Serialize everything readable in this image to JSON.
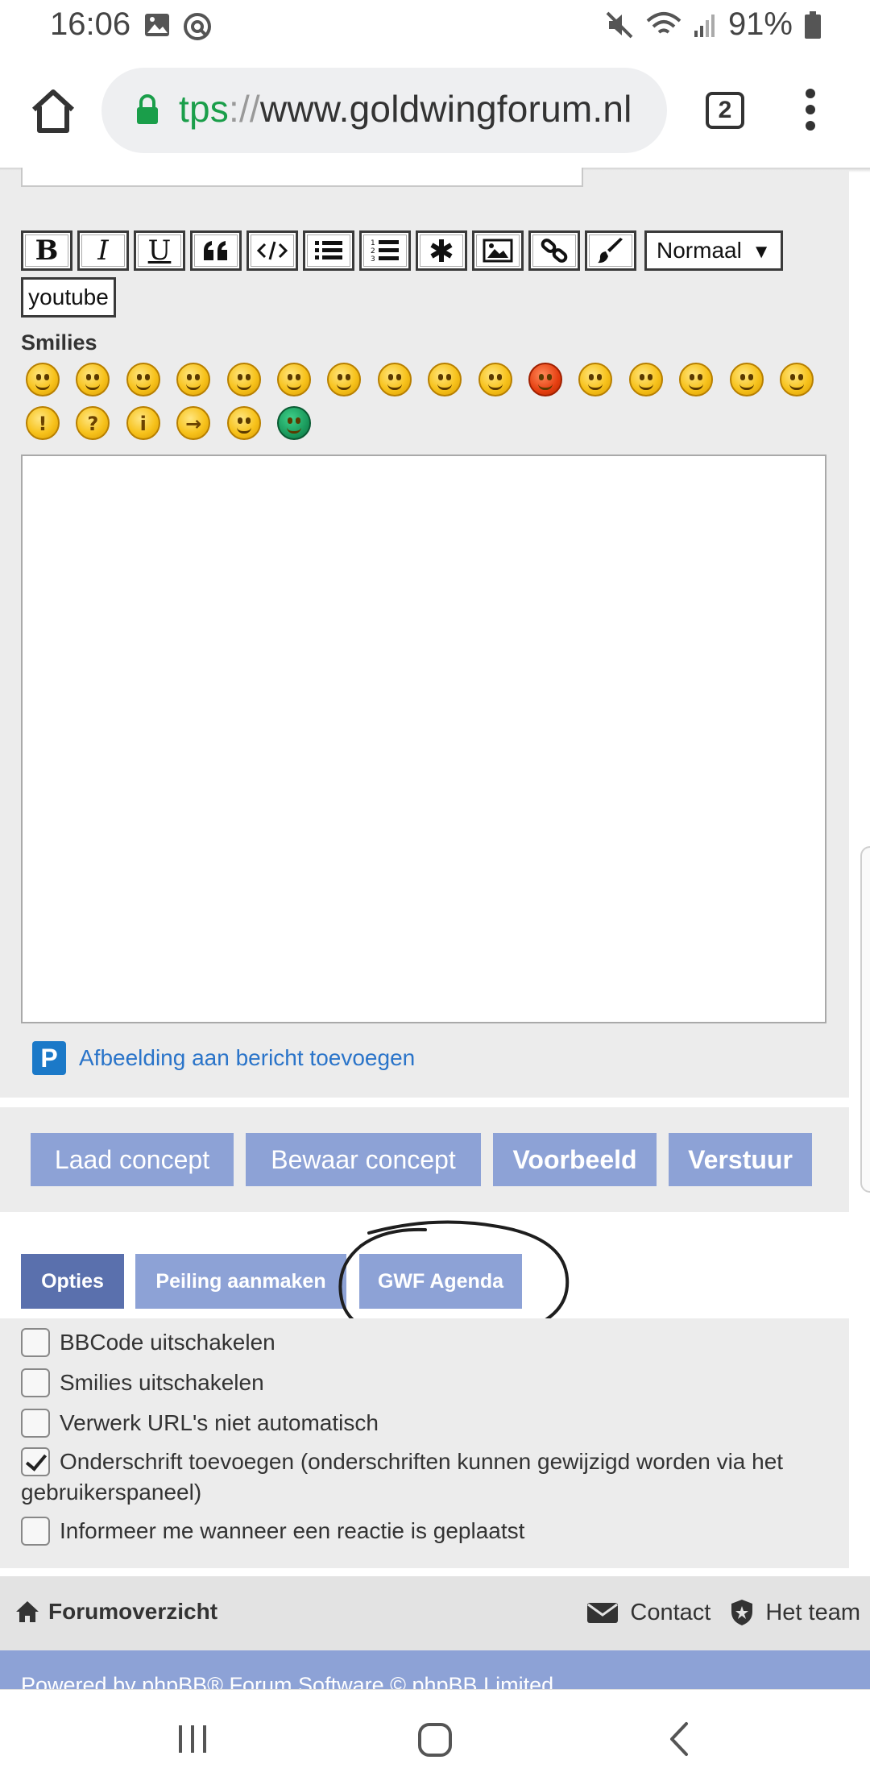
{
  "status_bar": {
    "time": "16:06",
    "battery": "91%"
  },
  "browser": {
    "url_proto": "tps",
    "url_sep": "://",
    "url_host": "www.goldwingforum.nl",
    "tab_count": "2"
  },
  "toolbar": {
    "buttons": [
      "B",
      "I",
      "U",
      "quote",
      "code",
      "list",
      "list-numbered",
      "list-item",
      "image",
      "link",
      "color"
    ],
    "size_select": "Normaal",
    "youtube_label": "youtube"
  },
  "smilies": {
    "label": "Smilies",
    "count_row1": 16,
    "count_row2": 6
  },
  "attach": {
    "label": "Afbeelding aan bericht toevoegen"
  },
  "actions": {
    "load_draft": "Laad concept",
    "save_draft": "Bewaar concept",
    "preview": "Voorbeeld",
    "submit": "Verstuur"
  },
  "tabs": {
    "options": "Opties",
    "poll": "Peiling aanmaken",
    "agenda": "GWF Agenda"
  },
  "options": [
    {
      "label": "BBCode uitschakelen",
      "checked": false
    },
    {
      "label": "Smilies uitschakelen",
      "checked": false
    },
    {
      "label": "Verwerk URL's niet automatisch",
      "checked": false
    },
    {
      "label": "Onderschrift toevoegen (onderschriften kunnen gewijzigd worden via het gebruikerspaneel)",
      "checked": true
    },
    {
      "label": "Informeer me wanneer een reactie is geplaatst",
      "checked": false
    }
  ],
  "footer": {
    "forum_index": "Forumoverzicht",
    "contact": "Contact",
    "team": "Het team",
    "powered": "Powered by phpBB® Forum Software © phpBB Limited"
  },
  "colors": {
    "button_blue": "#8da2d6",
    "tab_active": "#5a70ad",
    "panel_grey": "#ececec",
    "link_blue": "#2a74c9",
    "secure_green": "#1a9e4a"
  }
}
